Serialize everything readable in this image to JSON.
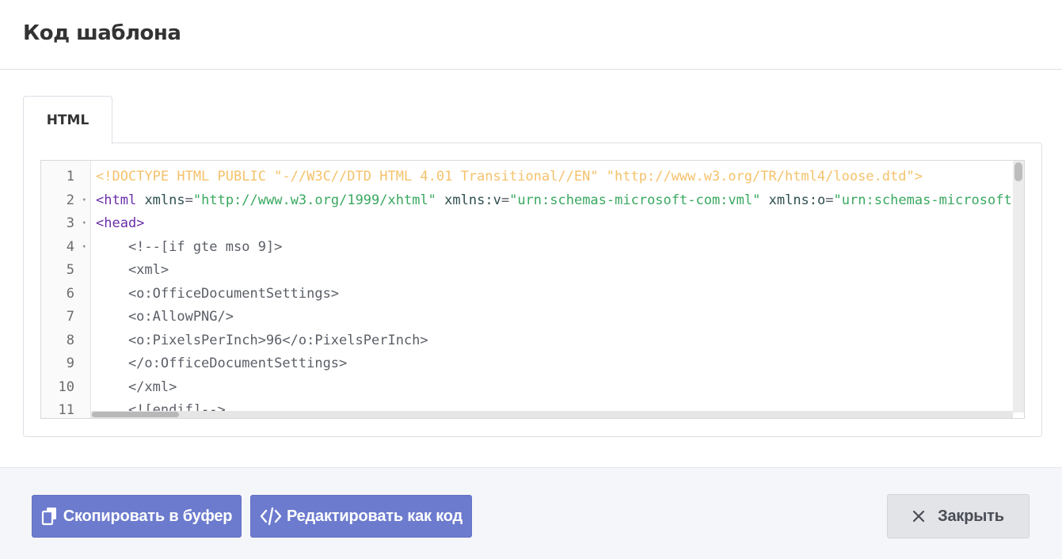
{
  "dialog": {
    "title": "Код шаблона"
  },
  "tabs": [
    {
      "label": "HTML",
      "active": true
    }
  ],
  "editor": {
    "line_numbers": [
      "1",
      "2",
      "3",
      "4",
      "5",
      "6",
      "7",
      "8",
      "9",
      "10",
      "11"
    ],
    "foldable_lines": [
      2,
      3,
      4
    ],
    "lines": [
      [
        {
          "t": "<!DOCTYPE HTML PUBLIC \"-//W3C//DTD HTML 4.01 Transitional//EN\" \"http://www.w3.org/TR/html4/loose.dtd\">",
          "c": "doctype"
        }
      ],
      [
        {
          "t": "<html",
          "c": "tag"
        },
        {
          "t": " ",
          "c": "punct"
        },
        {
          "t": "xmlns",
          "c": "attr"
        },
        {
          "t": "=",
          "c": "punct"
        },
        {
          "t": "\"http://www.w3.org/1999/xhtml\"",
          "c": "str"
        },
        {
          "t": " ",
          "c": "punct"
        },
        {
          "t": "xmlns:v",
          "c": "attr"
        },
        {
          "t": "=",
          "c": "punct"
        },
        {
          "t": "\"urn:schemas-microsoft-com:vml\"",
          "c": "str"
        },
        {
          "t": " ",
          "c": "punct"
        },
        {
          "t": "xmlns:o",
          "c": "attr"
        },
        {
          "t": "=",
          "c": "punct"
        },
        {
          "t": "\"urn:schemas-microsoft-com:office:office\"",
          "c": "str"
        }
      ],
      [
        {
          "t": "<head>",
          "c": "tag"
        }
      ],
      [
        {
          "t": "    <!--[if gte mso 9]>",
          "c": "punct"
        }
      ],
      [
        {
          "t": "    <xml>",
          "c": "punct"
        }
      ],
      [
        {
          "t": "    <o:OfficeDocumentSettings>",
          "c": "punct"
        }
      ],
      [
        {
          "t": "    <o:AllowPNG/>",
          "c": "punct"
        }
      ],
      [
        {
          "t": "    <o:PixelsPerInch>96</o:PixelsPerInch>",
          "c": "punct"
        }
      ],
      [
        {
          "t": "    </o:OfficeDocumentSettings>",
          "c": "punct"
        }
      ],
      [
        {
          "t": "    </xml>",
          "c": "punct"
        }
      ],
      [
        {
          "t": "    <![endif]-->",
          "c": "punct"
        }
      ]
    ]
  },
  "footer": {
    "copy_label": "Скопировать в буфер",
    "copy_icon": "copy-icon",
    "edit_label": "Редактировать как код",
    "edit_icon": "code-icon",
    "close_label": "Закрыть",
    "close_icon": "close-icon"
  },
  "colors": {
    "primary_button": "#6c7bce",
    "secondary_button": "#e3e4e8",
    "doctype": "#f5c26b",
    "tag": "#6a2ea8",
    "string": "#3aa860"
  }
}
